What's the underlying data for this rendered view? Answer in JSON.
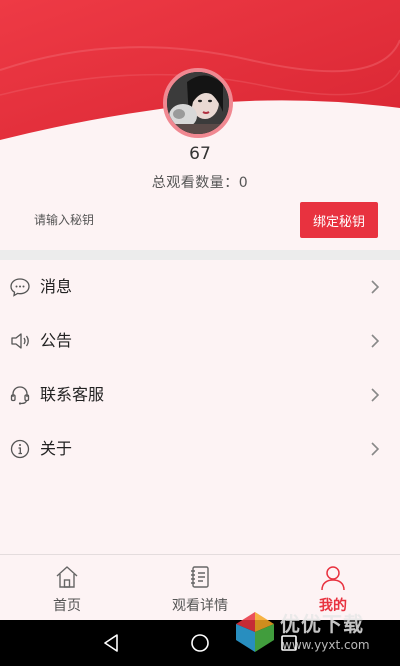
{
  "profile": {
    "username": "67",
    "views_label": "总观看数量：",
    "views_count": "0"
  },
  "key": {
    "placeholder": "请输入秘钥",
    "bind_label": "绑定秘钥"
  },
  "menu": {
    "items": [
      {
        "label": "消息",
        "icon": "message-icon"
      },
      {
        "label": "公告",
        "icon": "speaker-icon"
      },
      {
        "label": "联系客服",
        "icon": "headset-icon"
      },
      {
        "label": "关于",
        "icon": "info-icon"
      }
    ]
  },
  "tabs": [
    {
      "label": "首页",
      "icon": "home-icon",
      "active": false
    },
    {
      "label": "观看详情",
      "icon": "notebook-icon",
      "active": false
    },
    {
      "label": "我的",
      "icon": "user-icon",
      "active": true
    }
  ],
  "watermark": {
    "title": "优优下载",
    "url": "www.yyxt.com"
  },
  "colors": {
    "accent": "#e8323f",
    "header_red": "#e52f3b",
    "background": "#fdf3f4"
  }
}
